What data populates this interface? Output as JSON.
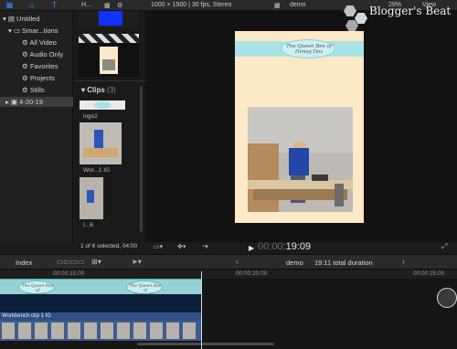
{
  "topbar": {
    "format_info": "1000 × 1500 | 30 fps, Stereo",
    "project_name": "demo",
    "zoom": "29%",
    "view_label": "View",
    "filter_label": "H..."
  },
  "sidebar": {
    "items": [
      {
        "label": "Untitled"
      },
      {
        "label": "Smar...tions"
      },
      {
        "label": "All Video"
      },
      {
        "label": "Audio Only"
      },
      {
        "label": "Favorites"
      },
      {
        "label": "Projects"
      },
      {
        "label": "Stills"
      },
      {
        "label": "4-20-19"
      }
    ]
  },
  "browser": {
    "clips_header": "Clips",
    "clips_count": "(3)",
    "clips": [
      {
        "label": "logo2"
      },
      {
        "label": "Wor...1 IG"
      },
      {
        "label": "I...6"
      }
    ],
    "footer": "1 of 6 selected, 04:00"
  },
  "viewer": {
    "banner_line1": "The Queen Bee of",
    "banner_line2": "Honey Dos",
    "timecode_dim": "00:00:",
    "timecode_bright": "19:09"
  },
  "timeline_header": {
    "index_label": "Index",
    "project": "demo",
    "duration": "19:11 total duration"
  },
  "ruler": {
    "labels": [
      "00:00:15:00",
      "00:00:20:00",
      "00:00:25:00"
    ]
  },
  "timeline": {
    "title_clip_line1": "The Queen Bee of",
    "title_clip_line2": "Honey Dos",
    "video_clip_label": "Workbench clip 1 IG"
  },
  "watermark": {
    "text": "Blogger's Beat"
  },
  "colors": {
    "accent": "#3a8dff",
    "canvas_bg": "#fce9c7",
    "banner": "#a9e2e5",
    "video_clip": "#3e5c8f"
  }
}
